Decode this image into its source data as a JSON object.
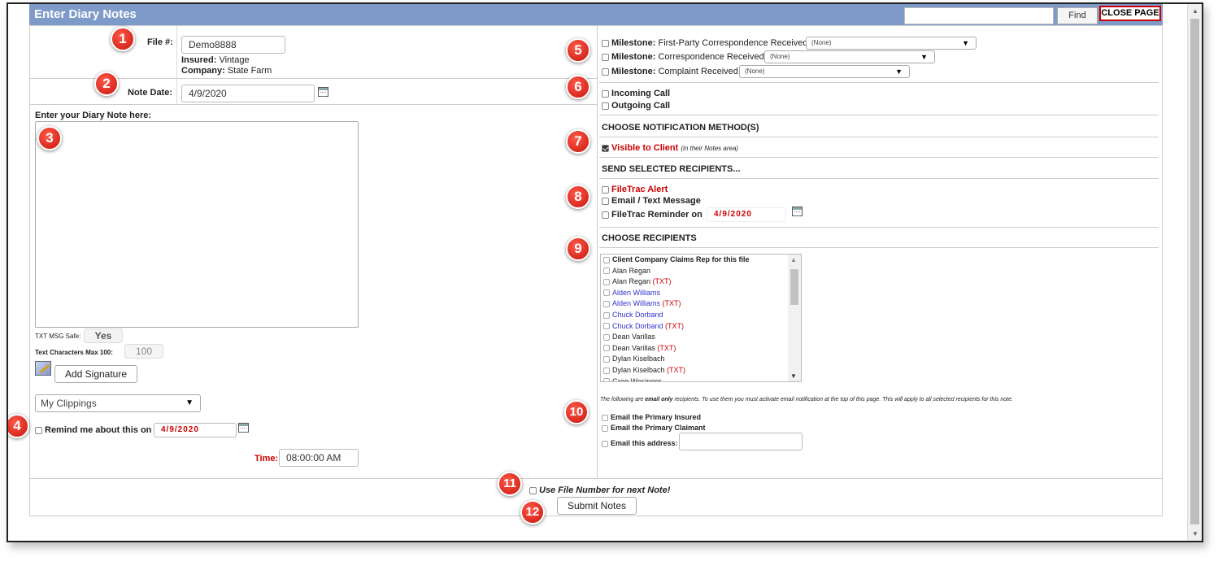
{
  "header": {
    "title": "Enter Diary Notes",
    "find_label": "Find",
    "close_label": "CLOSE PAGE",
    "find_placeholder": ""
  },
  "file": {
    "label": "File #:",
    "value": "Demo8888",
    "insured_label": "Insured:",
    "insured_value": "Vintage",
    "company_label": "Company:",
    "company_value": "State Farm"
  },
  "note_date": {
    "label": "Note Date:",
    "value": "4/9/2020"
  },
  "diary": {
    "label": "Enter your Diary Note here:",
    "value": ""
  },
  "txt_safe": {
    "label": "TXT MSG Safe:",
    "value": "Yes"
  },
  "text_max": {
    "label": "Text Characters Max 100:",
    "value": "100"
  },
  "signature_label": "Add Signature",
  "clippings": {
    "value": "My Clippings"
  },
  "remind": {
    "label": "Remind me about this on",
    "date": "4/9/2020",
    "time_label": "Time:",
    "time_value": "08:00:00 AM"
  },
  "milestones": [
    {
      "label": "Milestone:",
      "text": "First-Party Correspondence Received",
      "value": "(None)"
    },
    {
      "label": "Milestone:",
      "text": "Correspondence Received",
      "value": "(None)"
    },
    {
      "label": "Milestone:",
      "text": "Complaint Received",
      "value": "(None)"
    }
  ],
  "calls": {
    "incoming": "Incoming Call",
    "outgoing": "Outgoing Call"
  },
  "notification": {
    "heading": "CHOOSE NOTIFICATION METHOD(S)",
    "visible_label": "Visible to Client",
    "visible_note": "(in their Notes area)"
  },
  "send": {
    "heading": "SEND SELECTED RECIPIENTS...",
    "alert": "FileTrac Alert",
    "email_text": "Email / Text Message",
    "reminder": "FileTrac Reminder on",
    "reminder_date": "4/9/2020"
  },
  "recipients": {
    "heading": "CHOOSE RECIPIENTS",
    "items": [
      {
        "name": "Client Company Claims Rep for this file",
        "suffix": ""
      },
      {
        "name": "Alan Regan",
        "suffix": ""
      },
      {
        "name": "Alan Regan ",
        "suffix": "(TXT)"
      },
      {
        "name": "Alden Williams",
        "suffix": ""
      },
      {
        "name": "Alden Williams ",
        "suffix": "(TXT)"
      },
      {
        "name": "Chuck Dorband",
        "suffix": ""
      },
      {
        "name": "Chuck Dorband ",
        "suffix": "(TXT)"
      },
      {
        "name": "Dean Varillas",
        "suffix": ""
      },
      {
        "name": "Dean Varillas ",
        "suffix": "(TXT)"
      },
      {
        "name": "Dylan Kiselbach",
        "suffix": ""
      },
      {
        "name": "Dylan Kiselbach ",
        "suffix": "(TXT)"
      },
      {
        "name": "Greg Wesinger",
        "suffix": ""
      }
    ]
  },
  "email_only": {
    "note_pre": "The following are ",
    "note_em": "email only",
    "note_post": " recipients. To use them you must activate email notification at the top of this page. This will apply to all selected recipients for this note.",
    "primary_insured": "Email the Primary Insured",
    "primary_claimant": "Email the Primary Claimant",
    "address_label": "Email this address:",
    "address_value": ""
  },
  "footer": {
    "use_file_label": "Use File Number for next Note!",
    "submit_label": "Submit Notes"
  },
  "badges": [
    "1",
    "2",
    "3",
    "4",
    "5",
    "6",
    "7",
    "8",
    "9",
    "10",
    "11",
    "12"
  ],
  "colors": {
    "header_bg": "#7d9ac9",
    "badge": "#e0261b",
    "accent_red": "#cc0000",
    "link_blue": "#3333cc"
  }
}
